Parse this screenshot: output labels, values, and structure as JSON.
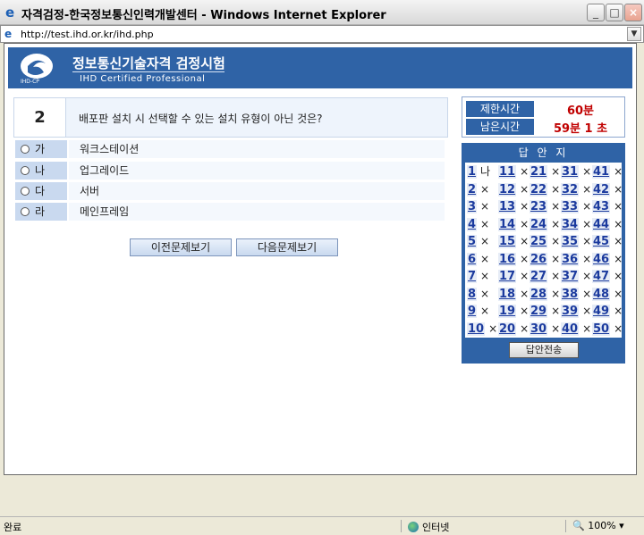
{
  "window": {
    "title": "자격검정-한국정보통신인력개발센터 - Windows Internet Explorer",
    "url": "http://test.ihd.or.kr/ihd.php",
    "ie_glyph": "e"
  },
  "header": {
    "brand_title": "정보통신기술자격 검정시험",
    "brand_subtitle": "IHD Certified Professional",
    "logo_text": "IHD-CP"
  },
  "question": {
    "number": "2",
    "text": "배포판 설치 시 선택할 수 있는 설치 유형이 아닌 것은?",
    "options": [
      {
        "mark": "가",
        "label": "워크스테이션"
      },
      {
        "mark": "나",
        "label": "업그레이드"
      },
      {
        "mark": "다",
        "label": "서버"
      },
      {
        "mark": "라",
        "label": "메인프레임"
      }
    ],
    "prev_label": "이전문제보기",
    "next_label": "다음문제보기"
  },
  "timer": {
    "limit_label": "제한시간",
    "limit_value": "60분",
    "remain_label": "남은시간",
    "remain_value": "59분 1 초"
  },
  "answer_sheet": {
    "title": "답 안 지",
    "submit_label": "답안전송",
    "answers": {
      "1": "나",
      "2": "×",
      "3": "×",
      "4": "×",
      "5": "×",
      "6": "×",
      "7": "×",
      "8": "×",
      "9": "×",
      "10": "×",
      "11": "×",
      "12": "×",
      "13": "×",
      "14": "×",
      "15": "×",
      "16": "×",
      "17": "×",
      "18": "×",
      "19": "×",
      "20": "×",
      "21": "×",
      "22": "×",
      "23": "×",
      "24": "×",
      "25": "×",
      "26": "×",
      "27": "×",
      "28": "×",
      "29": "×",
      "30": "×",
      "31": "×",
      "32": "×",
      "33": "×",
      "34": "×",
      "35": "×",
      "36": "×",
      "37": "×",
      "38": "×",
      "39": "×",
      "40": "×",
      "41": "×",
      "42": "×",
      "43": "×",
      "44": "×",
      "45": "×",
      "46": "×",
      "47": "×",
      "48": "×",
      "49": "×",
      "50": "×"
    }
  },
  "statusbar": {
    "status": "완료",
    "zone": "인터넷",
    "zoom": "100%"
  },
  "colors": {
    "header_blue": "#2f63a6",
    "time_red": "#c00000",
    "option_badge": "#c9d9ef"
  }
}
